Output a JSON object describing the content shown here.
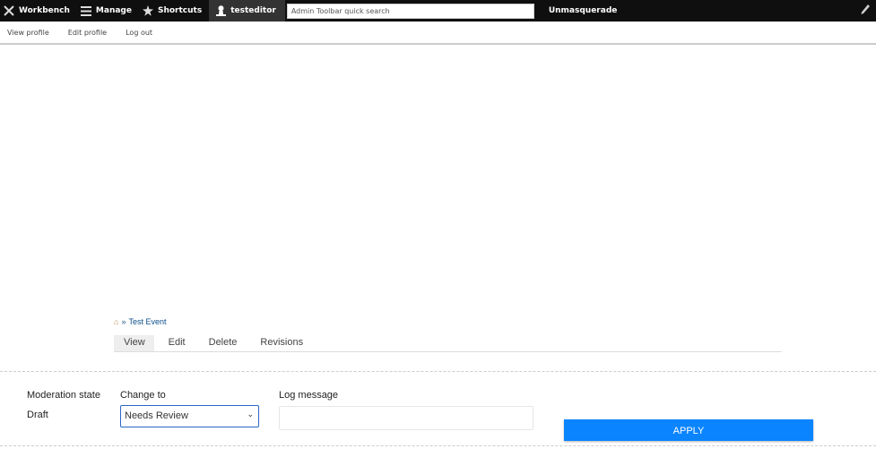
{
  "toolbar": {
    "workbench": "Workbench",
    "manage": "Manage",
    "shortcuts": "Shortcuts",
    "user": "testeditor",
    "search_placeholder": "Admin Toolbar quick search",
    "unmasquerade": "Unmasquerade"
  },
  "subbar": {
    "view_profile": "View profile",
    "edit_profile": "Edit profile",
    "log_out": "Log out"
  },
  "breadcrumb": {
    "separator": "»",
    "current": "Test Event"
  },
  "tabs": [
    {
      "label": "View",
      "active": true
    },
    {
      "label": "Edit"
    },
    {
      "label": "Delete"
    },
    {
      "label": "Revisions"
    }
  ],
  "moderation": {
    "state_label": "Moderation state",
    "state_value": "Draft",
    "change_to_label": "Change to",
    "change_to_value": "Needs Review",
    "log_label": "Log message",
    "log_value": "",
    "apply_label": "APPLY"
  },
  "colors": {
    "apply_button": "#0a84ff",
    "toolbar_bg": "#0f0f0f"
  }
}
